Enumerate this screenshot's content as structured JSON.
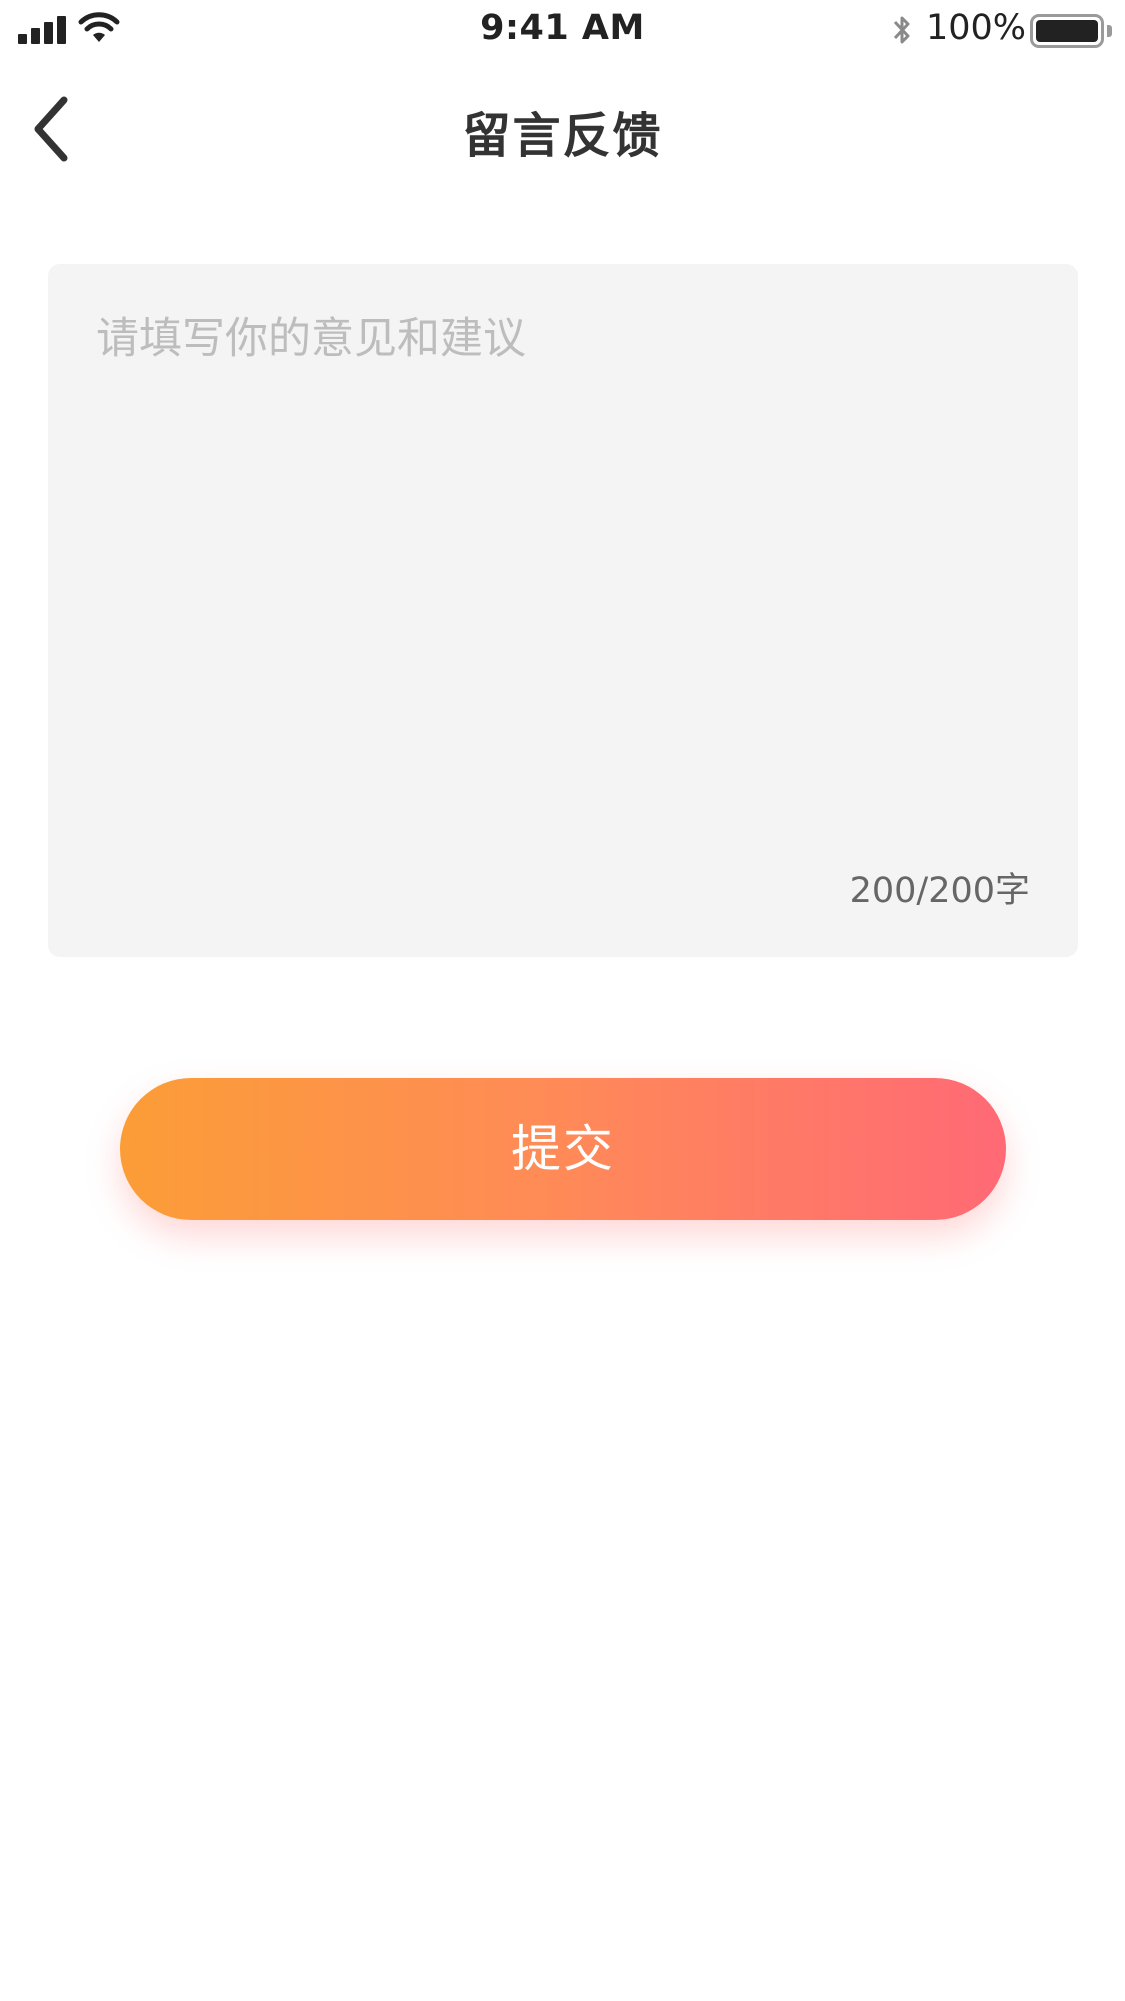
{
  "status_bar": {
    "time": "9:41 AM",
    "battery_percent": "100%",
    "signal_icon": "cellular-signal-icon",
    "wifi_icon": "wifi-icon",
    "bluetooth_icon": "bluetooth-icon",
    "battery_icon": "battery-icon",
    "battery_level": 1.0
  },
  "nav": {
    "back_icon": "chevron-left-icon",
    "title": "留言反馈"
  },
  "feedback": {
    "placeholder": "请填写你的意见和建议",
    "value": "",
    "counter": "200/200字"
  },
  "submit": {
    "label": "提交"
  },
  "colors": {
    "gradient_start": "#fb9d37",
    "gradient_end": "#ff6975",
    "input_background": "#f4f4f4",
    "placeholder": "#bdbdbd"
  }
}
